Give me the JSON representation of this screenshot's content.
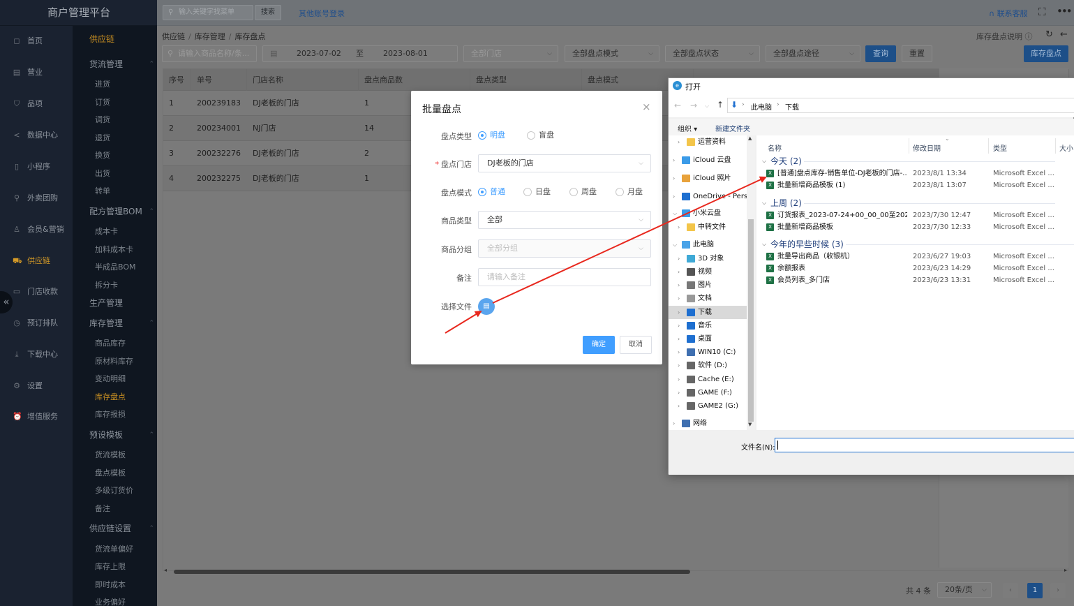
{
  "app": {
    "title": "商户管理平台"
  },
  "topbar": {
    "search_placeholder": "输入关键字找菜单",
    "search_button": "搜索",
    "other_login": "其他账号登录",
    "contact": "联系客服"
  },
  "nav_primary": [
    {
      "label": "首页",
      "icon": "home-icon",
      "glyph": "◻"
    },
    {
      "label": "营业",
      "icon": "calendar-icon",
      "glyph": "▤"
    },
    {
      "label": "品项",
      "icon": "bag-icon",
      "glyph": "⛉"
    },
    {
      "label": "数据中心",
      "icon": "share-icon",
      "glyph": "<"
    },
    {
      "label": "小程序",
      "icon": "phone-icon",
      "glyph": "▯"
    },
    {
      "label": "外卖团购",
      "icon": "bike-icon",
      "glyph": "⚲"
    },
    {
      "label": "会员&营销",
      "icon": "user-icon",
      "glyph": "♙"
    },
    {
      "label": "供应链",
      "icon": "truck-icon",
      "glyph": "⛟"
    },
    {
      "label": "门店收款",
      "icon": "wallet-icon",
      "glyph": "▭"
    },
    {
      "label": "预订排队",
      "icon": "clock-icon",
      "glyph": "◷"
    },
    {
      "label": "下载中心",
      "icon": "download-icon",
      "glyph": "⤓"
    },
    {
      "label": "设置",
      "icon": "gear-icon",
      "glyph": "⚙"
    },
    {
      "label": "增值服务",
      "icon": "alarm-icon",
      "glyph": "⏰"
    }
  ],
  "nav_secondary": {
    "header": "供应链",
    "items": [
      {
        "label": "货流管理",
        "group": true
      },
      {
        "label": "进货"
      },
      {
        "label": "订货"
      },
      {
        "label": "调货"
      },
      {
        "label": "退货"
      },
      {
        "label": "换货"
      },
      {
        "label": "出货"
      },
      {
        "label": "转单"
      },
      {
        "label": "配方管理BOM",
        "group": true
      },
      {
        "label": "成本卡"
      },
      {
        "label": "加料成本卡"
      },
      {
        "label": "半成品BOM"
      },
      {
        "label": "拆分卡"
      },
      {
        "label": "生产管理",
        "group": true,
        "nochev": true
      },
      {
        "label": "库存管理",
        "group": true
      },
      {
        "label": "商品库存"
      },
      {
        "label": "原材料库存"
      },
      {
        "label": "变动明细"
      },
      {
        "label": "库存盘点",
        "active": true
      },
      {
        "label": "库存报损"
      },
      {
        "label": "预设模板",
        "group": true
      },
      {
        "label": "货流模板"
      },
      {
        "label": "盘点模板"
      },
      {
        "label": "多级订货价"
      },
      {
        "label": "备注"
      },
      {
        "label": "供应链设置",
        "group": true
      },
      {
        "label": "货流单偏好"
      },
      {
        "label": "库存上限"
      },
      {
        "label": "即时成本"
      },
      {
        "label": "业务偏好"
      }
    ]
  },
  "breadcrumb": [
    "供应链",
    "库存管理",
    "库存盘点"
  ],
  "header_actions": {
    "help": "库存盘点说明"
  },
  "filters": {
    "name_placeholder": "请输入商品名称/条...",
    "date_from": "2023-07-02",
    "date_sep": "至",
    "date_to": "2023-08-01",
    "store": "全部门店",
    "mode": "全部盘点模式",
    "status": "全部盘点状态",
    "channel": "全部盘点途径",
    "query": "查询",
    "reset": "重置",
    "stocktake": "库存盘点"
  },
  "table": {
    "columns": [
      "序号",
      "单号",
      "门店名称",
      "盘点商品数",
      "盘点类型",
      "盘点模式"
    ],
    "rows": [
      [
        "1",
        "200239183",
        "DJ老板的门店",
        "1"
      ],
      [
        "2",
        "200234001",
        "NJ门店",
        "14"
      ],
      [
        "3",
        "200232276",
        "DJ老板的门店",
        "2"
      ],
      [
        "4",
        "200232275",
        "DJ老板的门店",
        "1"
      ]
    ]
  },
  "pagination": {
    "total": "共 4 条",
    "page_size": "20条/页",
    "current": "1"
  },
  "modal": {
    "title": "批量盘点",
    "type_label": "盘点类型",
    "type_options": [
      "明盘",
      "盲盘"
    ],
    "type_selected": 0,
    "store_label": "盘点门店",
    "store_value": "DJ老板的门店",
    "mode_label": "盘点模式",
    "mode_options": [
      "普通",
      "日盘",
      "周盘",
      "月盘"
    ],
    "mode_selected": 0,
    "goods_type_label": "商品类型",
    "goods_type_value": "全部",
    "goods_group_label": "商品分组",
    "goods_group_placeholder": "全部分组",
    "remark_label": "备注",
    "remark_placeholder": "请输入备注",
    "file_label": "选择文件",
    "ok": "确定",
    "cancel": "取消"
  },
  "file_dialog": {
    "title": "打开",
    "path": [
      "此电脑",
      "下载"
    ],
    "organize": "组织 ▾",
    "new_folder": "新建文件夹",
    "tree": [
      {
        "label": "运营资料",
        "indent": 2,
        "color": "#f3c54a"
      },
      {
        "label": "iCloud 云盘",
        "indent": 1,
        "color": "#3b9be8"
      },
      {
        "label": "iCloud 照片",
        "indent": 1,
        "color": "#e8a23b"
      },
      {
        "label": "OneDrive - Perso",
        "indent": 1,
        "color": "#1e6fd0"
      },
      {
        "label": "小米云盘",
        "indent": 1,
        "color": "#3b9be8",
        "expanded": true
      },
      {
        "label": "中转文件",
        "indent": 2,
        "color": "#f3c54a"
      },
      {
        "label": "此电脑",
        "indent": 1,
        "color": "#4aa3e8",
        "expanded": true
      },
      {
        "label": "3D 对象",
        "indent": 2,
        "color": "#3fa9d6"
      },
      {
        "label": "视频",
        "indent": 2,
        "color": "#555555"
      },
      {
        "label": "图片",
        "indent": 2,
        "color": "#777777"
      },
      {
        "label": "文档",
        "indent": 2,
        "color": "#999999"
      },
      {
        "label": "下载",
        "indent": 2,
        "color": "#1e6fd0",
        "selected": true
      },
      {
        "label": "音乐",
        "indent": 2,
        "color": "#1e6fd0"
      },
      {
        "label": "桌面",
        "indent": 2,
        "color": "#1e6fd0"
      },
      {
        "label": "WIN10 (C:)",
        "indent": 2,
        "color": "#3f6fb0"
      },
      {
        "label": "软件 (D:)",
        "indent": 2,
        "color": "#666666"
      },
      {
        "label": "Cache (E:)",
        "indent": 2,
        "color": "#666666"
      },
      {
        "label": "GAME (F:)",
        "indent": 2,
        "color": "#666666"
      },
      {
        "label": "GAME2 (G:)",
        "indent": 2,
        "color": "#666666"
      },
      {
        "label": "网络",
        "indent": 1,
        "color": "#3f6fb0"
      }
    ],
    "columns": [
      "名称",
      "修改日期",
      "类型",
      "大小"
    ],
    "groups": [
      {
        "label": "今天 (2)",
        "files": [
          {
            "name": "[普通]盘点库存-销售单位-DJ老板的门店-...",
            "date": "2023/8/1 13:34",
            "type": "Microsoft Excel ..."
          },
          {
            "name": "批量新增商品模板 (1)",
            "date": "2023/8/1 13:07",
            "type": "Microsoft Excel ..."
          }
        ]
      },
      {
        "label": "上周 (2)",
        "files": [
          {
            "name": "订货报表_2023-07-24+00_00_00至202...",
            "date": "2023/7/30 12:47",
            "type": "Microsoft Excel ..."
          },
          {
            "name": "批量新增商品模板",
            "date": "2023/7/30 12:33",
            "type": "Microsoft Excel ..."
          }
        ]
      },
      {
        "label": "今年的早些时候 (3)",
        "files": [
          {
            "name": "批量导出商品（收银机）",
            "date": "2023/6/27 19:03",
            "type": "Microsoft Excel ..."
          },
          {
            "name": "余额报表",
            "date": "2023/6/23 14:29",
            "type": "Microsoft Excel ..."
          },
          {
            "name": "会员列表_多门店",
            "date": "2023/6/23 13:31",
            "type": "Microsoft Excel ..."
          }
        ]
      }
    ],
    "filename_label": "文件名(N):",
    "filename_value": ""
  },
  "colors": {
    "sidebar_bg": "#1a2230",
    "accent_orange": "#d49a27",
    "primary_blue": "#409eff",
    "annotation_red": "#e8281e"
  }
}
